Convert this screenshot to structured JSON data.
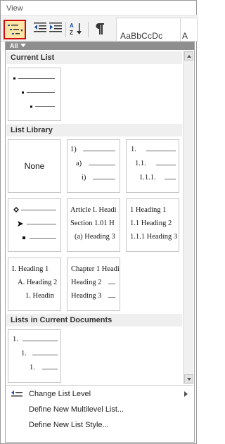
{
  "window": {
    "tab_label": "View"
  },
  "ribbon": {
    "style_preview": "AaBbCcDc",
    "style_preview_2": "A"
  },
  "dropdown": {
    "filter_label": "All",
    "sections": {
      "current_list": "Current List",
      "list_library": "List Library",
      "lists_in_documents": "Lists in Current Documents"
    },
    "library": {
      "none_label": "None",
      "numbered": [
        "1)",
        "a)",
        "i)"
      ],
      "decimal": [
        "1.",
        "1.1.",
        "1.1.1."
      ],
      "article": [
        "Article I. Headi",
        "Section 1.01 H",
        "(a) Heading 3"
      ],
      "heading_numbered": [
        "1 Heading 1",
        "1.1 Heading 2",
        "1.1.1 Heading 3"
      ],
      "roman_heading": [
        "I. Heading 1",
        "A. Heading 2",
        "1. Headin"
      ],
      "chapter": [
        "Chapter 1 Headi",
        "Heading 2",
        "Heading 3"
      ]
    },
    "document_list": [
      "1.",
      "1.",
      "1."
    ],
    "menu": [
      {
        "label": "Change List Level",
        "has_submenu": true
      },
      {
        "label": "Define New Multilevel List...",
        "has_submenu": false
      },
      {
        "label": "Define New List Style...",
        "has_submenu": false
      }
    ]
  },
  "colors": {
    "highlight_border": "#d00d0d",
    "active_button": "#fde7a8",
    "filter_bar": "#8e8e8e"
  }
}
